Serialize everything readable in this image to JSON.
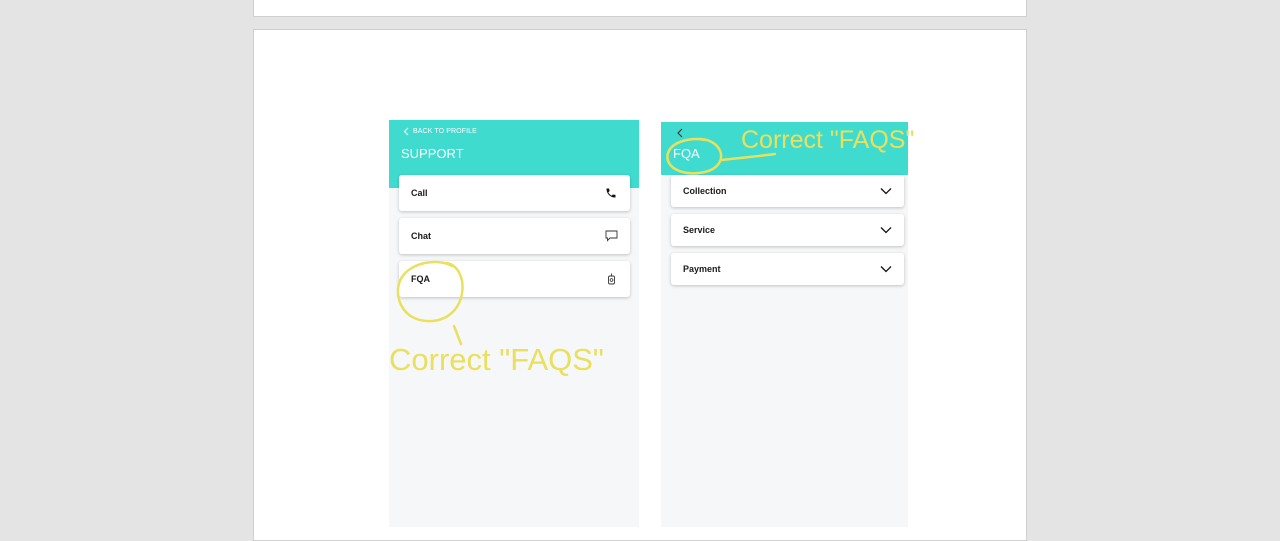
{
  "support_screen": {
    "back_label": "BACK TO PROFILE",
    "title": "SUPPORT",
    "items": [
      {
        "label": "Call",
        "icon": "phone-icon"
      },
      {
        "label": "Chat",
        "icon": "chat-bubble-icon"
      },
      {
        "label": "FQA",
        "icon": "faq-icon"
      }
    ]
  },
  "faq_screen": {
    "title": "FQA",
    "items": [
      {
        "label": "Collection",
        "icon": "chevron-down-icon"
      },
      {
        "label": "Service",
        "icon": "chevron-down-icon"
      },
      {
        "label": "Payment",
        "icon": "chevron-down-icon"
      }
    ]
  },
  "annotations": [
    {
      "text": "Correct \"FAQS\""
    },
    {
      "text": "Correct \"FAQS\""
    }
  ],
  "colors": {
    "teal_header": "#3fdbcf",
    "annotation": "#e9e05e",
    "background": "#e4e4e4"
  }
}
